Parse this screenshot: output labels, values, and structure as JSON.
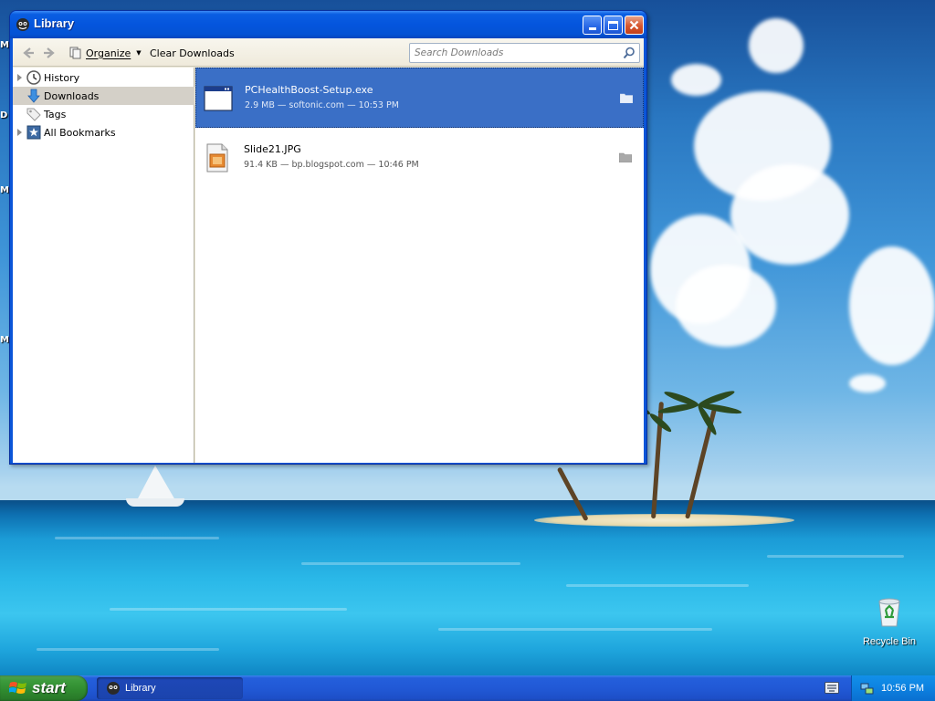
{
  "window": {
    "title": "Library",
    "icon": "firefox-library-icon"
  },
  "toolbar": {
    "organize_label": "Organize",
    "clear_downloads_label": "Clear Downloads",
    "search_placeholder": "Search Downloads"
  },
  "sidebar": {
    "items": [
      {
        "label": "History",
        "icon": "clock-icon",
        "expandable": true
      },
      {
        "label": "Downloads",
        "icon": "download-arrow-icon",
        "expandable": false,
        "selected": true
      },
      {
        "label": "Tags",
        "icon": "tag-icon",
        "expandable": false
      },
      {
        "label": "All Bookmarks",
        "icon": "bookmark-star-icon",
        "expandable": true
      }
    ]
  },
  "downloads": [
    {
      "name": "PCHealthBoost-Setup.exe",
      "meta": "2.9 MB — softonic.com — 10:53 PM",
      "icon": "exe-window-icon",
      "selected": true
    },
    {
      "name": "Slide21.JPG",
      "meta": "91.4 KB — bp.blogspot.com — 10:46 PM",
      "icon": "image-file-icon",
      "selected": false
    }
  ],
  "desktop": {
    "recycle_bin_label": "Recycle Bin",
    "edge_fragments": [
      "M",
      "D",
      "M",
      "M"
    ]
  },
  "taskbar": {
    "start_label": "start",
    "task_label": "Library",
    "clock": "10:56 PM"
  },
  "colors": {
    "selection": "#3a6fc6",
    "xp_title_blue": "#0455dd",
    "start_green": "#2f8a2f"
  }
}
